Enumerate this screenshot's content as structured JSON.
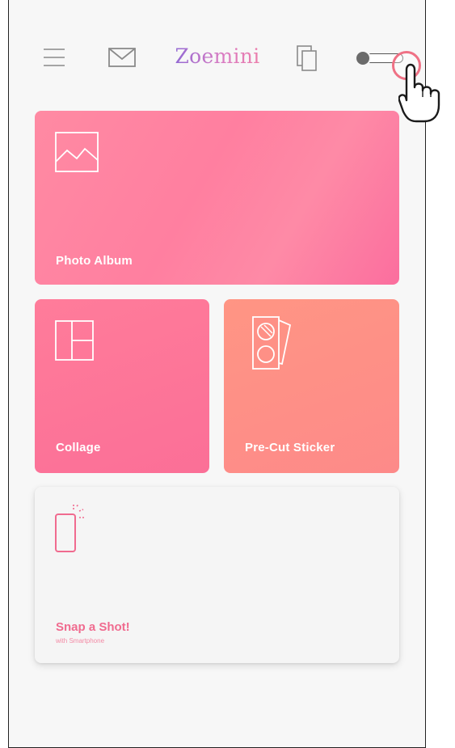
{
  "header": {
    "brand": "Zoemini",
    "icons": {
      "menu": "hamburger-menu-icon",
      "mail": "envelope-icon",
      "copies": "copies-icon",
      "toggle": "toggle-switch"
    },
    "toggle_state": "off"
  },
  "cards": {
    "photo_album": {
      "label": "Photo Album",
      "icon": "image-icon"
    },
    "collage": {
      "label": "Collage",
      "icon": "collage-layout-icon"
    },
    "sticker": {
      "label": "Pre-Cut Sticker",
      "icon": "sticker-sheet-icon"
    },
    "snap": {
      "label": "Snap a Shot!",
      "sublabel": "with Smartphone",
      "icon": "smartphone-icon"
    }
  },
  "colors": {
    "accent_pink": "#f06b8f",
    "brand_purple": "#8b68d6",
    "photo_album_bg": "#ff7fa0",
    "collage_bg": "#fb6f97",
    "sticker_bg": "#ff9584",
    "tap_ring": "#ef7185"
  }
}
